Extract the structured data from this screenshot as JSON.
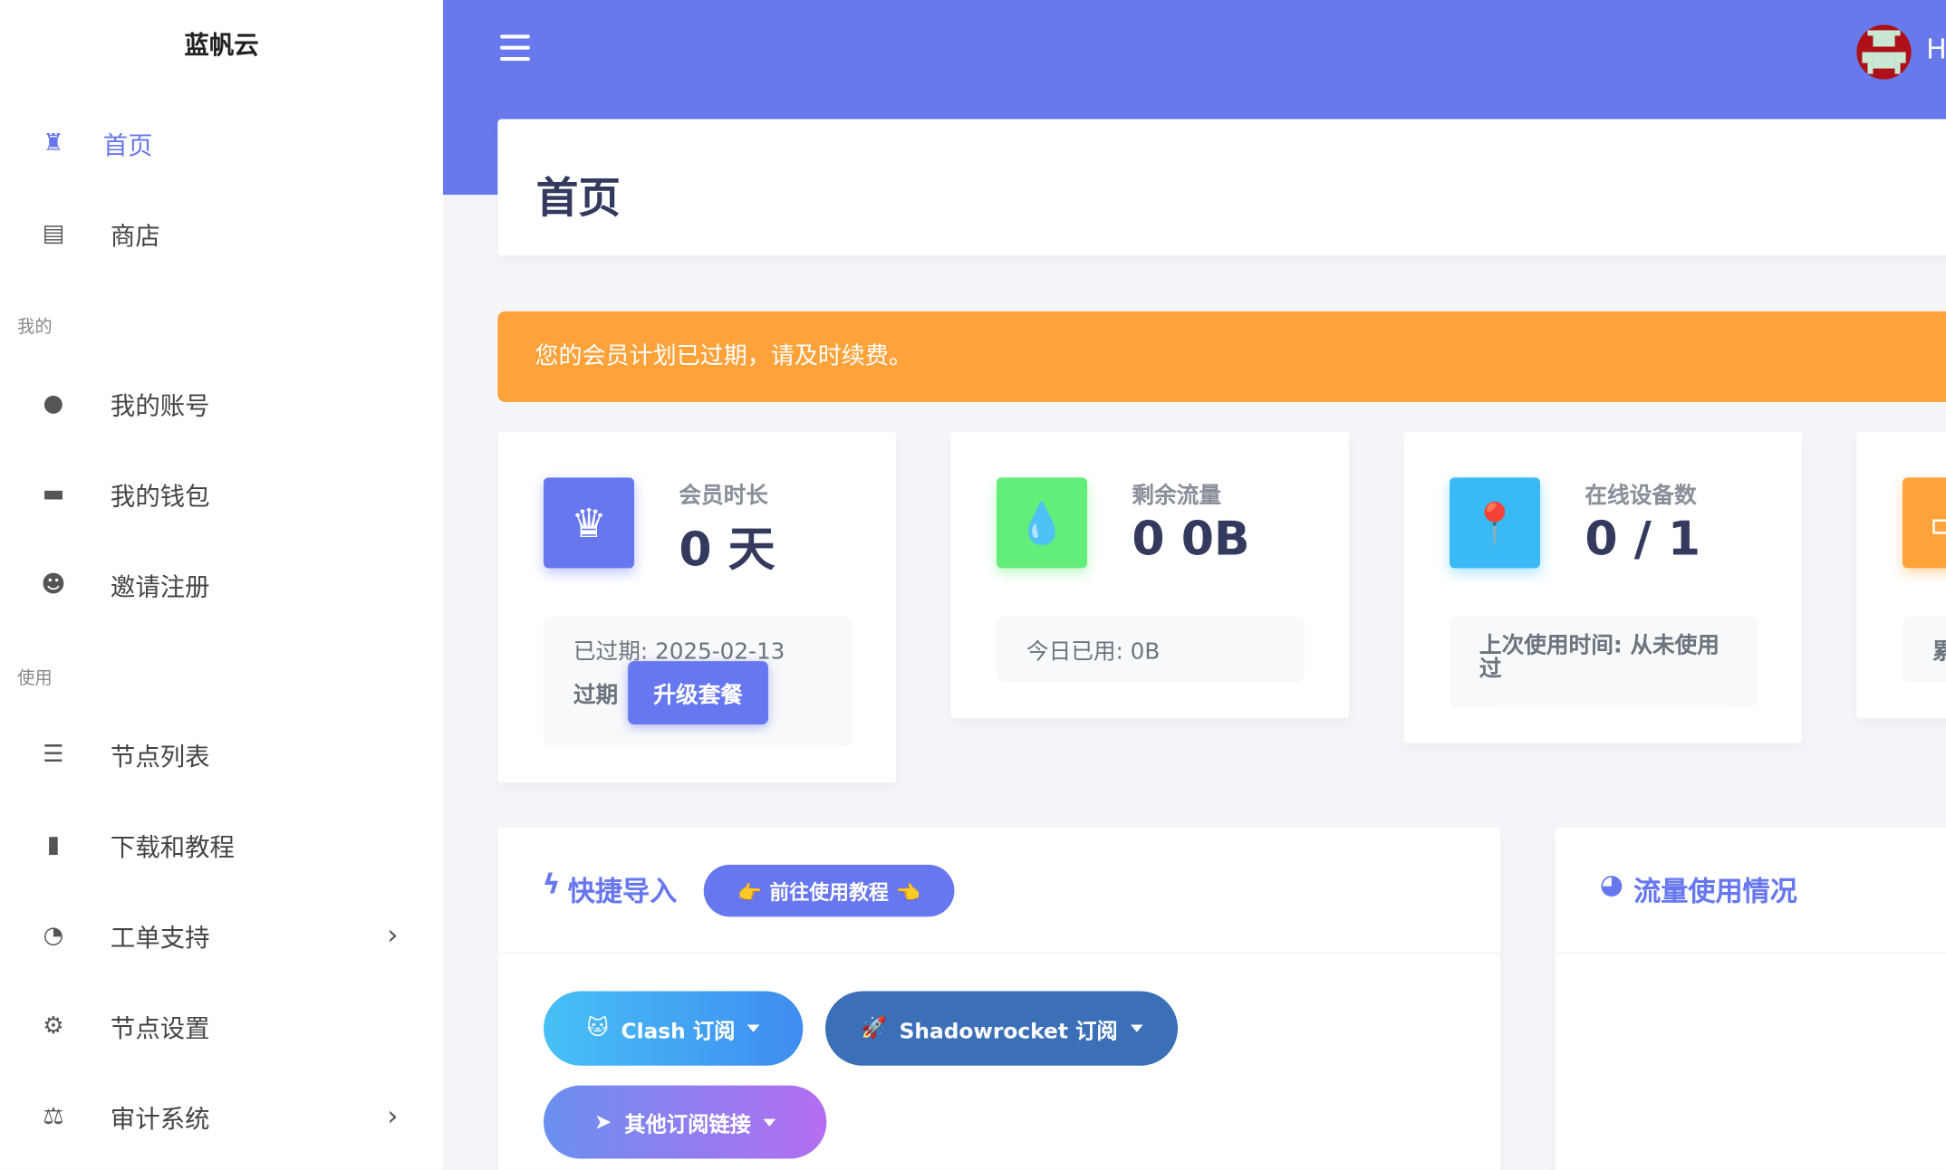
{
  "brand": "蓝帆云",
  "colors": {
    "primary": "#6777ef",
    "warning": "#ffa23a",
    "success": "#63ed7a",
    "info": "#3abaf4"
  },
  "sidebar": {
    "items": [
      {
        "label": "首页",
        "icon": "castle-icon",
        "active": true
      },
      {
        "label": "商店",
        "icon": "store-icon"
      },
      {
        "section": "我的"
      },
      {
        "label": "我的账号",
        "icon": "user-icon"
      },
      {
        "label": "我的钱包",
        "icon": "wallet-icon"
      },
      {
        "label": "邀请注册",
        "icon": "laugh-icon"
      },
      {
        "section": "使用"
      },
      {
        "label": "节点列表",
        "icon": "server-icon"
      },
      {
        "label": "下载和教程",
        "icon": "book-icon"
      },
      {
        "label": "工单支持",
        "icon": "headset-icon",
        "chevron": true
      },
      {
        "label": "节点设置",
        "icon": "gear-icon"
      },
      {
        "label": "审计系统",
        "icon": "balance-scale-icon",
        "chevron": true
      }
    ]
  },
  "header": {
    "user_initial": "H"
  },
  "page": {
    "title": "首页"
  },
  "alert": "您的会员计划已过期，请及时续费。",
  "stats": [
    {
      "label": "会员时长",
      "value": "0 天",
      "footer": "已过期: 2025-02-13",
      "footer2": "过期",
      "button": "升级套餐",
      "icon": "crown-icon"
    },
    {
      "label": "剩余流量",
      "value": "0 0B",
      "footer": "今日已用: 0B",
      "icon": "droplet-icon"
    },
    {
      "label": "在线设备数",
      "value": "0 / 1",
      "footer": "上次使用时间: 从未使用过",
      "icon": "map-marker-icon"
    },
    {
      "footer": "累",
      "icon": "calendar-icon"
    }
  ],
  "quick": {
    "title": "快捷导入",
    "tutorial": "👉 前往使用教程 👈",
    "clash": "Clash 订阅",
    "shadowrocket": "Shadowrocket 订阅",
    "other": "其他订阅链接"
  },
  "traffic": {
    "title": "流量使用情况"
  }
}
